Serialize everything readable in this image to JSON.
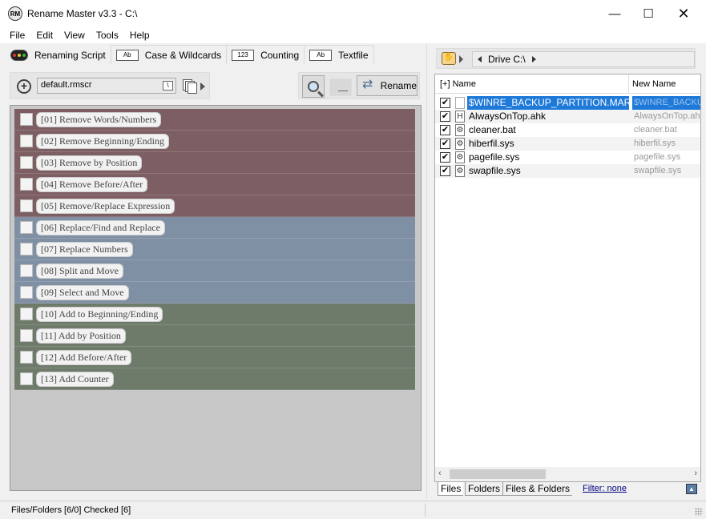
{
  "window": {
    "title": "Rename Master v3.3 - C:\\",
    "app_icon_text": "RM",
    "minimize": "—",
    "maximize": "☐",
    "close": "✕"
  },
  "menu": [
    "File",
    "Edit",
    "View",
    "Tools",
    "Help"
  ],
  "tabs": [
    {
      "label": "Renaming Script",
      "icon": "script-icon",
      "active": true
    },
    {
      "label": "Case & Wildcards",
      "icon": "ab-icon",
      "icon_text": "Ab"
    },
    {
      "label": "Counting",
      "icon": "numbers-icon",
      "icon_text": "123"
    },
    {
      "label": "Textfile",
      "icon": "textfile-icon",
      "icon_text": "Ab"
    }
  ],
  "script": {
    "file": "default.rmscr",
    "dropdown_glyph": "\\",
    "add_glyph": "+"
  },
  "actions": {
    "rename_label": "Rename"
  },
  "rules": [
    {
      "label": "[01]  Remove Words/Numbers",
      "group": "remove"
    },
    {
      "label": "[02]  Remove Beginning/Ending",
      "group": "remove"
    },
    {
      "label": "[03]  Remove by Position",
      "group": "remove"
    },
    {
      "label": "[04]  Remove Before/After",
      "group": "remove"
    },
    {
      "label": "[05]  Remove/Replace Expression",
      "group": "remove"
    },
    {
      "label": "[06]  Replace/Find and Replace",
      "group": "replace"
    },
    {
      "label": "[07]  Replace Numbers",
      "group": "replace"
    },
    {
      "label": "[08]  Split and Move",
      "group": "replace"
    },
    {
      "label": "[09]  Select and Move",
      "group": "replace"
    },
    {
      "label": "[10]  Add to Beginning/Ending",
      "group": "add"
    },
    {
      "label": "[11]  Add by Position",
      "group": "add"
    },
    {
      "label": "[12]  Add Before/After",
      "group": "add"
    },
    {
      "label": "[13]  Add Counter",
      "group": "add"
    }
  ],
  "path": {
    "label": "Drive C:\\"
  },
  "file_list": {
    "col_name": "[+] Name",
    "col_new": "New Name",
    "check_glyph": "✔",
    "rows": [
      {
        "name": "$WINRE_BACKUP_PARTITION.MARKER",
        "new": "$WINRE_BACKUP_PARTITION.MARKER",
        "icon": "",
        "selected": true
      },
      {
        "name": "AlwaysOnTop.ahk",
        "new": "AlwaysOnTop.ahk",
        "icon": "H"
      },
      {
        "name": "cleaner.bat",
        "new": "cleaner.bat",
        "icon": "⚙"
      },
      {
        "name": "hiberfil.sys",
        "new": "hiberfil.sys",
        "icon": "⚙"
      },
      {
        "name": "pagefile.sys",
        "new": "pagefile.sys",
        "icon": "⚙"
      },
      {
        "name": "swapfile.sys",
        "new": "swapfile.sys",
        "icon": "⚙"
      }
    ]
  },
  "bottom_tabs": [
    "Files",
    "Folders",
    "Files & Folders"
  ],
  "filter_label": "Filter:  none",
  "status": "Files/Folders [6/0] Checked [6]"
}
